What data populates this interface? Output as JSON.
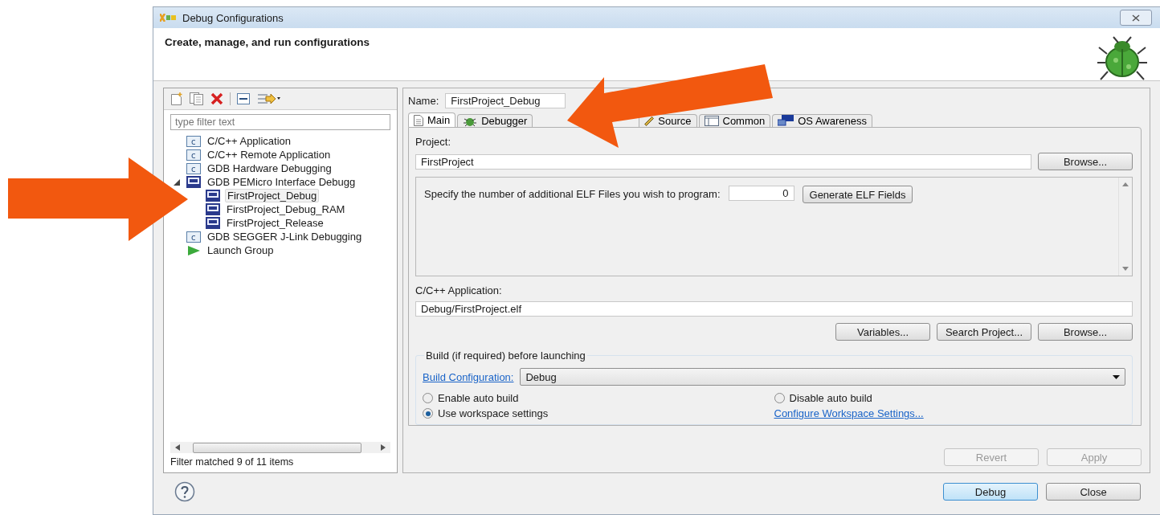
{
  "window": {
    "title": "Debug Configurations"
  },
  "header": {
    "title": "Create, manage, and run configurations"
  },
  "filter": {
    "placeholder": "type filter text"
  },
  "tree": [
    {
      "label": "C/C++ Application",
      "kind": "c"
    },
    {
      "label": "C/C++ Remote Application",
      "kind": "c"
    },
    {
      "label": "GDB Hardware Debugging",
      "kind": "c"
    },
    {
      "label": "GDB PEMicro Interface Debugg",
      "kind": "pe",
      "expanded": true,
      "children": [
        {
          "label": "FirstProject_Debug",
          "kind": "pe",
          "selected": true
        },
        {
          "label": "FirstProject_Debug_RAM",
          "kind": "pe",
          "selected": false
        },
        {
          "label": "FirstProject_Release",
          "kind": "pe",
          "selected": false
        }
      ]
    },
    {
      "label": "GDB SEGGER J-Link Debugging",
      "kind": "c"
    },
    {
      "label": "Launch Group",
      "kind": "launch"
    }
  ],
  "filter_status": "Filter matched 9 of 11 items",
  "name": {
    "label": "Name:",
    "value": "FirstProject_Debug"
  },
  "tabs": [
    {
      "label": "Main",
      "kind": "main",
      "selected": true
    },
    {
      "label": "Debugger",
      "kind": "debugger",
      "selected": false
    },
    {
      "label": "Source",
      "kind": "source",
      "selected": false
    },
    {
      "label": "Common",
      "kind": "common",
      "selected": false
    },
    {
      "label": "OS Awareness",
      "kind": "os",
      "selected": false
    }
  ],
  "project": {
    "label": "Project:",
    "value": "FirstProject",
    "button": "Browse..."
  },
  "elf": {
    "label": "Specify the number of additional ELF Files you wish to program:",
    "value": "0",
    "button": "Generate ELF Fields"
  },
  "application": {
    "label": "C/C++ Application:",
    "value": "Debug/FirstProject.elf",
    "buttons": [
      "Variables...",
      "Search Project...",
      "Browse..."
    ]
  },
  "build": {
    "title": "Build (if required) before launching",
    "config_link": "Build Configuration:",
    "config_value": "Debug",
    "options": [
      {
        "label": "Enable auto build",
        "selected": false
      },
      {
        "label": "Disable auto build",
        "selected": false
      },
      {
        "label": "Use workspace settings",
        "selected": true
      }
    ],
    "workspace_link": "Configure Workspace Settings..."
  },
  "form_buttons": [
    {
      "label": "Revert",
      "disabled": true
    },
    {
      "label": "Apply",
      "disabled": true
    }
  ],
  "dialog_buttons": [
    {
      "label": "Debug",
      "default": true
    },
    {
      "label": "Close",
      "default": false
    }
  ]
}
